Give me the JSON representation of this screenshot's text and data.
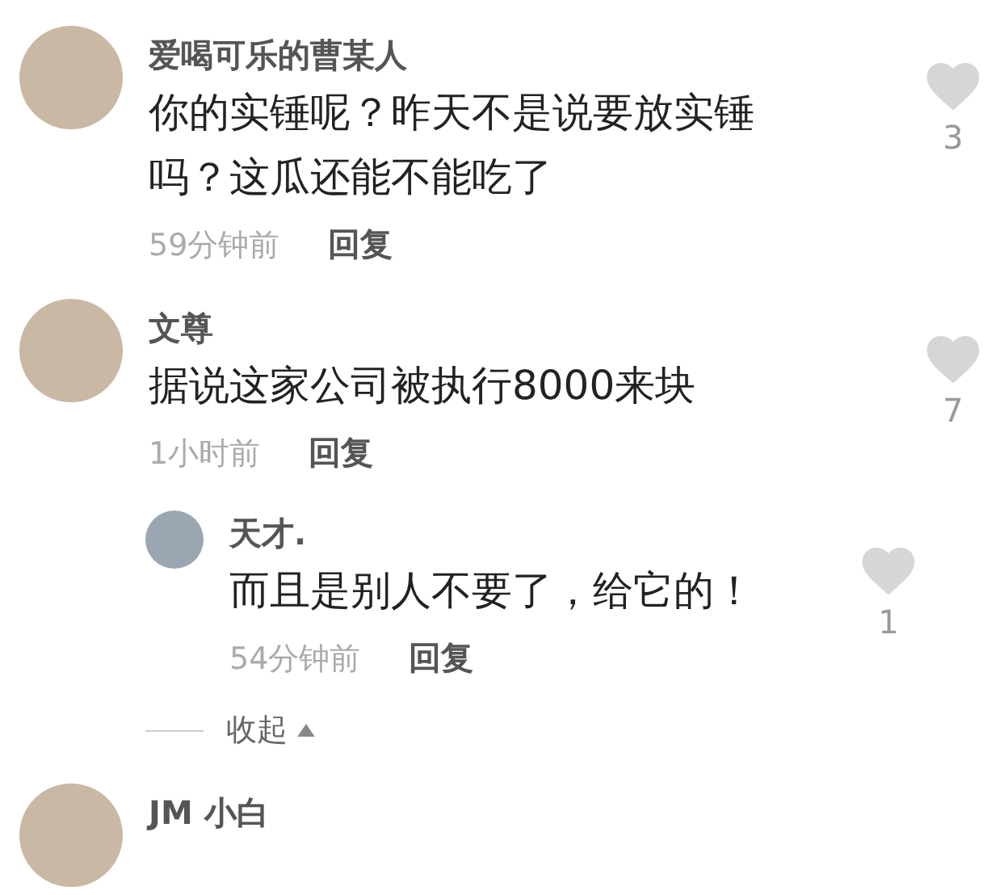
{
  "comments": [
    {
      "author": "爱喝可乐的曹某人",
      "text": "你的实锤呢？昨天不是说要放实锤吗？这瓜还能不能吃了",
      "time": "59分钟前",
      "reply_label": "回复",
      "likes": "3"
    },
    {
      "author": "文尊",
      "text": "据说这家公司被执行8000来块",
      "time": "1小时前",
      "reply_label": "回复",
      "likes": "7",
      "replies": [
        {
          "author": "天才.",
          "text": "而且是别人不要了，给它的！",
          "time": "54分钟前",
          "reply_label": "回复",
          "likes": "1"
        }
      ],
      "collapse_label": "收起"
    },
    {
      "author": "JM 小白"
    }
  ]
}
